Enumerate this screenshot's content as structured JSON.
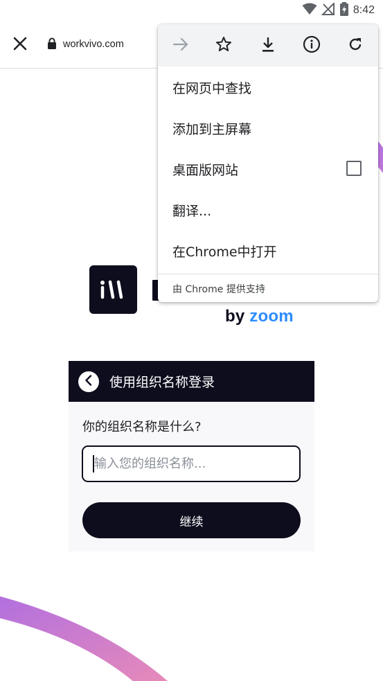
{
  "status_bar": {
    "time": "8:42",
    "icons": [
      "wifi-icon",
      "no-signal-icon",
      "battery-charging-icon"
    ]
  },
  "toolbar": {
    "close_icon": "close-icon",
    "lock_icon": "lock-icon",
    "url": "workvivo.com"
  },
  "menu": {
    "top_icons": [
      "forward-arrow-icon",
      "bookmark-star-icon",
      "download-icon",
      "info-icon",
      "reload-icon"
    ],
    "items": [
      {
        "label": "在网页中查找"
      },
      {
        "label": "添加到主屏幕"
      },
      {
        "label": "桌面版网站",
        "checked": false
      },
      {
        "label": "翻译..."
      },
      {
        "label": "在Chrome中打开"
      }
    ],
    "footer": "由 Chrome 提供支持"
  },
  "brand": {
    "byline_by": "by",
    "byline_zoom": "zoom",
    "colors": {
      "dark": "#0d0d1e",
      "zoom_blue": "#2d8cff",
      "arc_start": "#b06fe0",
      "arc_end": "#e98bb8"
    }
  },
  "login": {
    "header_title": "使用组织名称登录",
    "question": "你的组织名称是什么?",
    "input_value": "",
    "input_placeholder": "输入您的组织名称...",
    "continue_label": "继续"
  }
}
